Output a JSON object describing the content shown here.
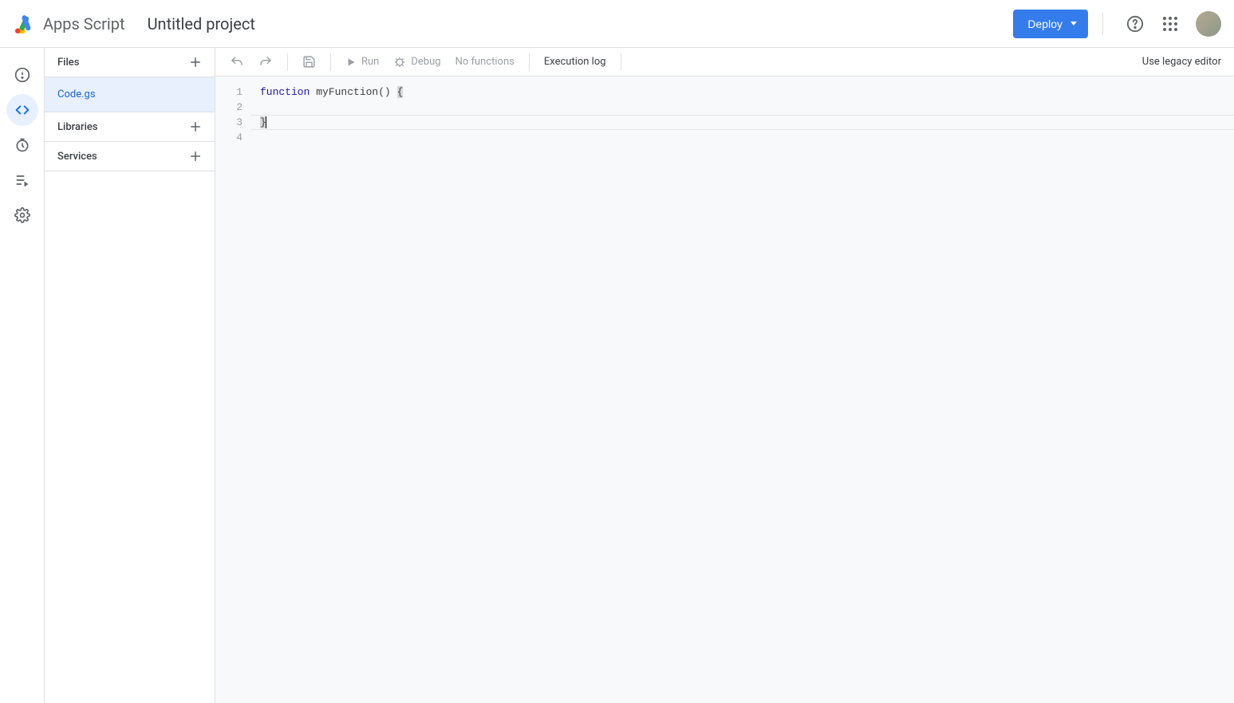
{
  "header": {
    "app_title": "Apps Script",
    "project_title": "Untitled project",
    "deploy_label": "Deploy"
  },
  "nav_rail": {
    "items": [
      "overview",
      "editor",
      "triggers",
      "executions",
      "settings"
    ],
    "active": "editor"
  },
  "files_panel": {
    "sections": {
      "files_label": "Files",
      "libraries_label": "Libraries",
      "services_label": "Services"
    },
    "files": [
      {
        "name": "Code.gs",
        "selected": true
      }
    ]
  },
  "toolbar": {
    "run_label": "Run",
    "debug_label": "Debug",
    "function_selector": "No functions",
    "execution_log_label": "Execution log",
    "legacy_label": "Use legacy editor"
  },
  "editor": {
    "lines": [
      "1",
      "2",
      "3",
      "4"
    ],
    "code": {
      "keyword": "function",
      "fn_decl": " myFunction() ",
      "open_brace": "{",
      "indent": "  ",
      "close_brace": "}"
    },
    "cursor_line": 3
  },
  "colors": {
    "accent": "#1a73e8",
    "deploy_bg": "#347cec",
    "selection_bg": "#e8f0fe",
    "keyword": "#1a1aa6"
  }
}
